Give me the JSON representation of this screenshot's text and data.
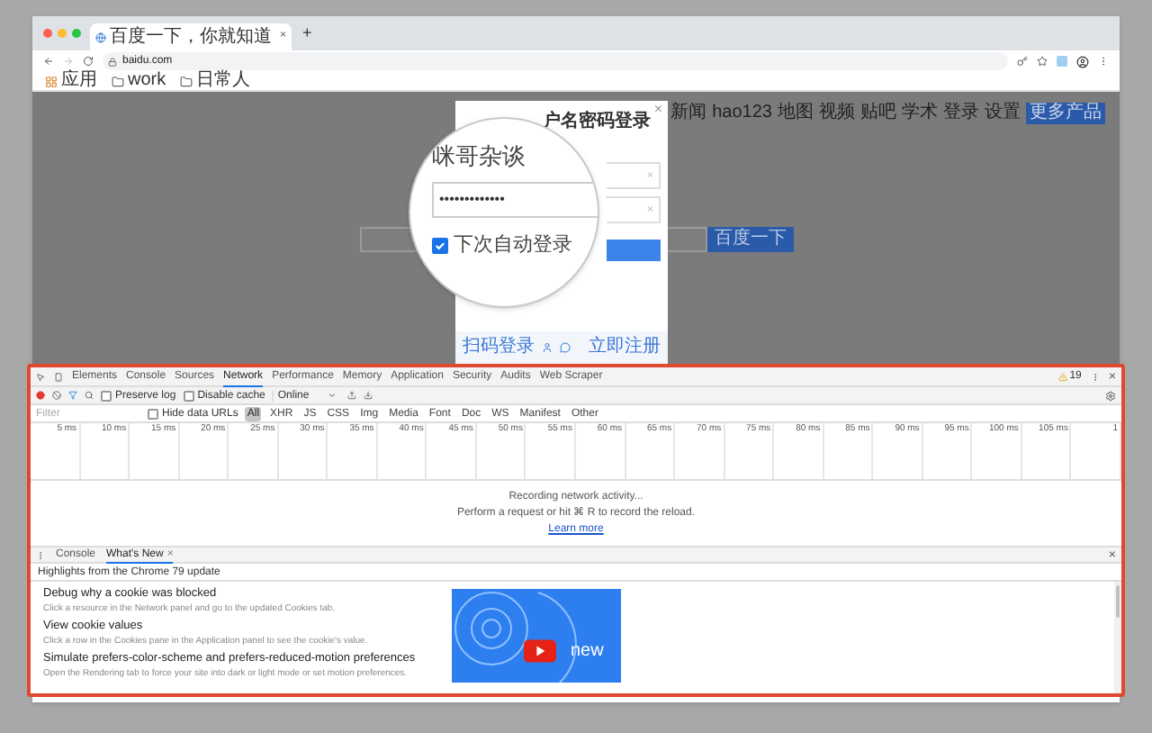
{
  "browser": {
    "tab_title": "百度一下，你就知道",
    "tab_close": "×",
    "new_tab": "+",
    "url": "baidu.com",
    "bookmarks": [
      {
        "label": "应用",
        "kind": "apps"
      },
      {
        "label": "work",
        "kind": "folder"
      },
      {
        "label": "日常人",
        "kind": "folder"
      }
    ]
  },
  "page": {
    "nav": [
      "新闻",
      "hao123",
      "地图",
      "视频",
      "贴吧",
      "学术",
      "登录",
      "设置"
    ],
    "nav_button": "更多产品",
    "search_button": "百度一下"
  },
  "login_dialog": {
    "title": "户名密码登录",
    "close": "×",
    "clear_marks": [
      "×",
      "×"
    ],
    "footer_left": "扫码登录",
    "footer_right": "立即注册"
  },
  "magnifier": {
    "username": "咪哥杂谈",
    "password": "•••••••••••••",
    "remember": {
      "label": "下次自动登录",
      "checked": true
    }
  },
  "devtools": {
    "tabs": [
      {
        "label": "Elements",
        "selected": false
      },
      {
        "label": "Console",
        "selected": false
      },
      {
        "label": "Sources",
        "selected": false
      },
      {
        "label": "Network",
        "selected": true
      },
      {
        "label": "Performance",
        "selected": false
      },
      {
        "label": "Memory",
        "selected": false
      },
      {
        "label": "Application",
        "selected": false
      },
      {
        "label": "Security",
        "selected": false
      },
      {
        "label": "Audits",
        "selected": false
      },
      {
        "label": "Web Scraper",
        "selected": false
      }
    ],
    "warning_count": "19",
    "close": "×",
    "toolbar": {
      "preserve_log": {
        "label": "Preserve log",
        "checked": false
      },
      "disable_cache": {
        "label": "Disable cache",
        "checked": false
      },
      "throttle": "Online"
    },
    "filter": {
      "placeholder": "Filter",
      "hide_data_urls": {
        "label": "Hide data URLs",
        "checked": false
      },
      "types": [
        {
          "label": "All",
          "selected": true
        },
        {
          "label": "XHR",
          "selected": false
        },
        {
          "label": "JS",
          "selected": false
        },
        {
          "label": "CSS",
          "selected": false
        },
        {
          "label": "Img",
          "selected": false
        },
        {
          "label": "Media",
          "selected": false
        },
        {
          "label": "Font",
          "selected": false
        },
        {
          "label": "Doc",
          "selected": false
        },
        {
          "label": "WS",
          "selected": false
        },
        {
          "label": "Manifest",
          "selected": false
        },
        {
          "label": "Other",
          "selected": false
        }
      ]
    },
    "timeline_ticks": [
      "5 ms",
      "10 ms",
      "15 ms",
      "20 ms",
      "25 ms",
      "30 ms",
      "35 ms",
      "40 ms",
      "45 ms",
      "50 ms",
      "55 ms",
      "60 ms",
      "65 ms",
      "70 ms",
      "75 ms",
      "80 ms",
      "85 ms",
      "90 ms",
      "95 ms",
      "100 ms",
      "105 ms",
      "1"
    ],
    "empty": {
      "title": "Recording network activity...",
      "hint": "Perform a request or hit ⌘ R to record the reload.",
      "link": "Learn more"
    },
    "drawer": {
      "tabs": [
        {
          "label": "Console",
          "selected": false
        },
        {
          "label": "What's New",
          "selected": true,
          "close": "×"
        }
      ],
      "close": "×",
      "heading": "Highlights from the Chrome 79 update",
      "items": [
        {
          "title": "Debug why a cookie was blocked",
          "description": "Click a resource in the Network panel and go to the updated Cookies tab."
        },
        {
          "title": "View cookie values",
          "description": "Click a row in the Cookies pane in the Application panel to see the cookie's value."
        },
        {
          "title": "Simulate prefers-color-scheme and prefers-reduced-motion preferences",
          "description": "Open the Rendering tab to force your site into dark or light mode or set motion preferences."
        }
      ],
      "video_caption": "new"
    }
  }
}
